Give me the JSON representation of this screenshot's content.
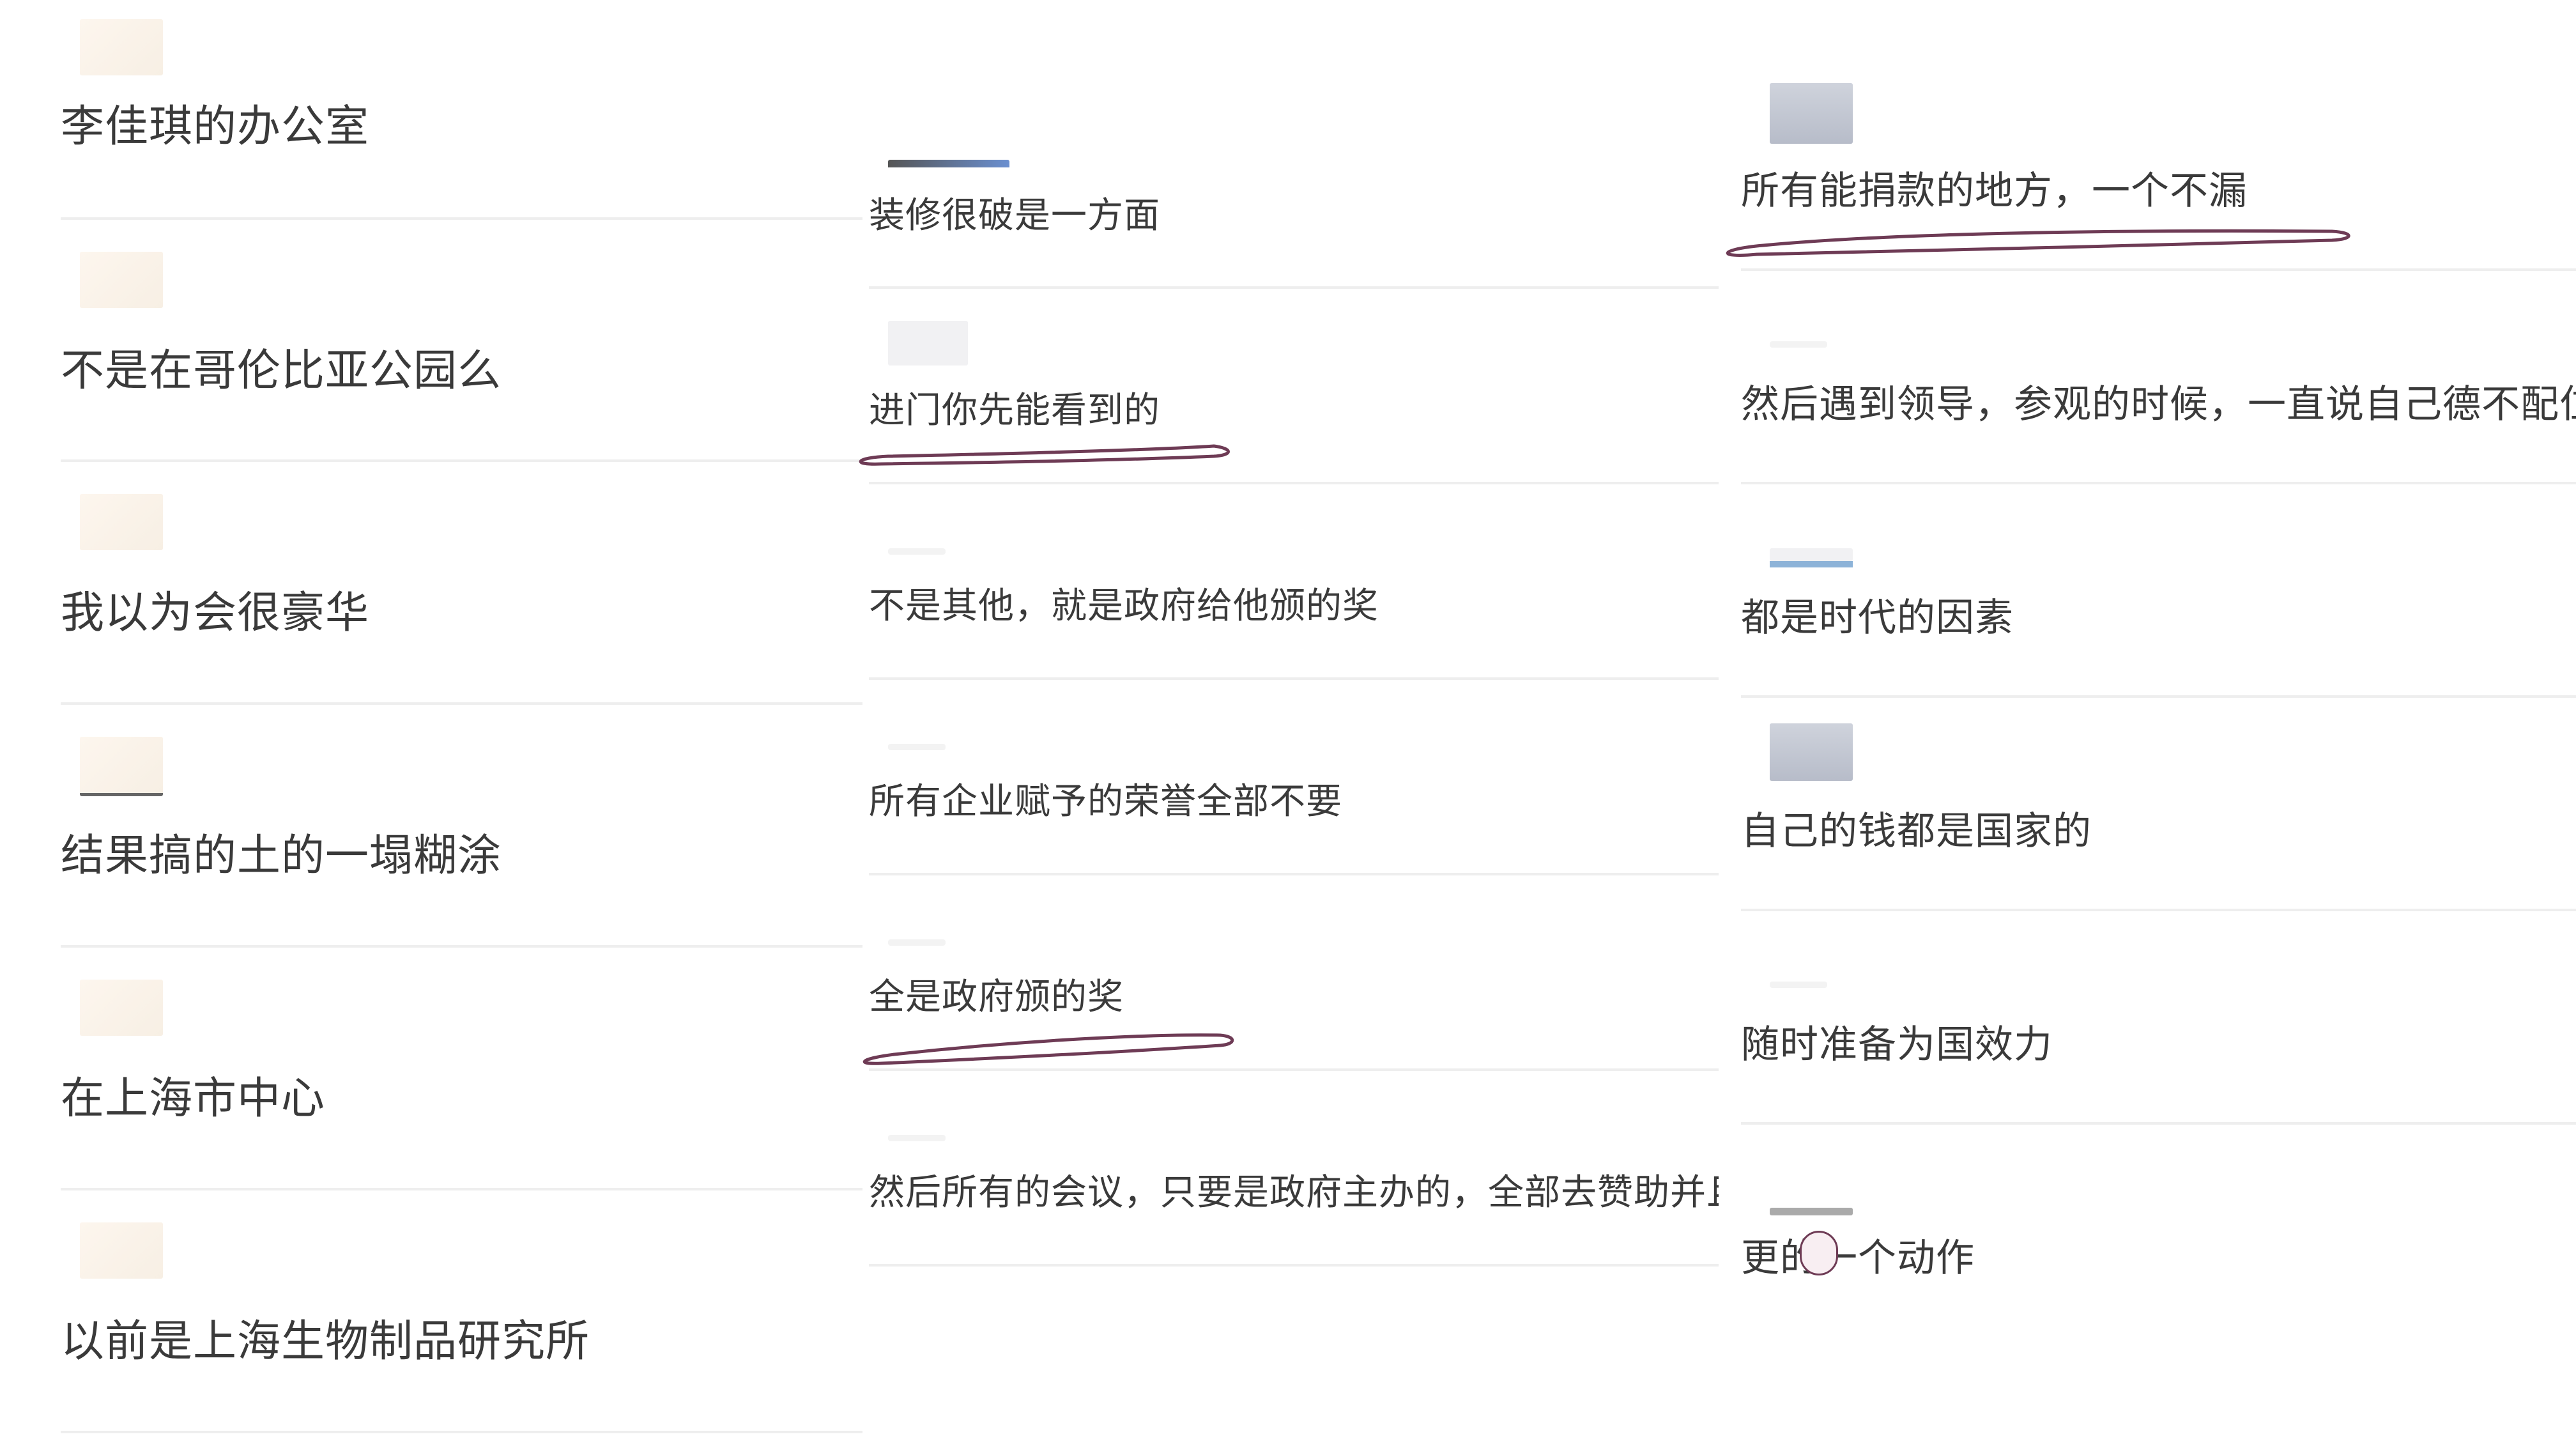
{
  "col1": {
    "messages": [
      "李佳琪的办公室",
      "不是在哥伦比亚公园么",
      "我以为会很豪华",
      "结果搞的土的一塌糊涂",
      "在上海市中心",
      "以前是上海生物制品研究所"
    ]
  },
  "col2": {
    "messages": [
      "装修很破是一方面",
      "进门你先能看到的",
      "不是其他，就是政府给他颁的奖",
      "所有企业赋予的荣誉全部不要",
      "全是政府颁的奖",
      "然后所有的会议，只要是政府主办的，全部去赞助并且"
    ]
  },
  "col3": {
    "messages": [
      "所有能捐款的地方，一个不漏",
      "然后遇到领导，参观的时候，一直说自己德不配位",
      "都是时代的因素",
      "自己的钱都是国家的",
      "随时准备为国效力",
      "更的一个动作"
    ]
  },
  "colors": {
    "underline": "#6e3b55",
    "divider": "#eeeeee",
    "text": "#3a3a3a"
  },
  "icons": {
    "avatar": "user-avatar-icon"
  }
}
